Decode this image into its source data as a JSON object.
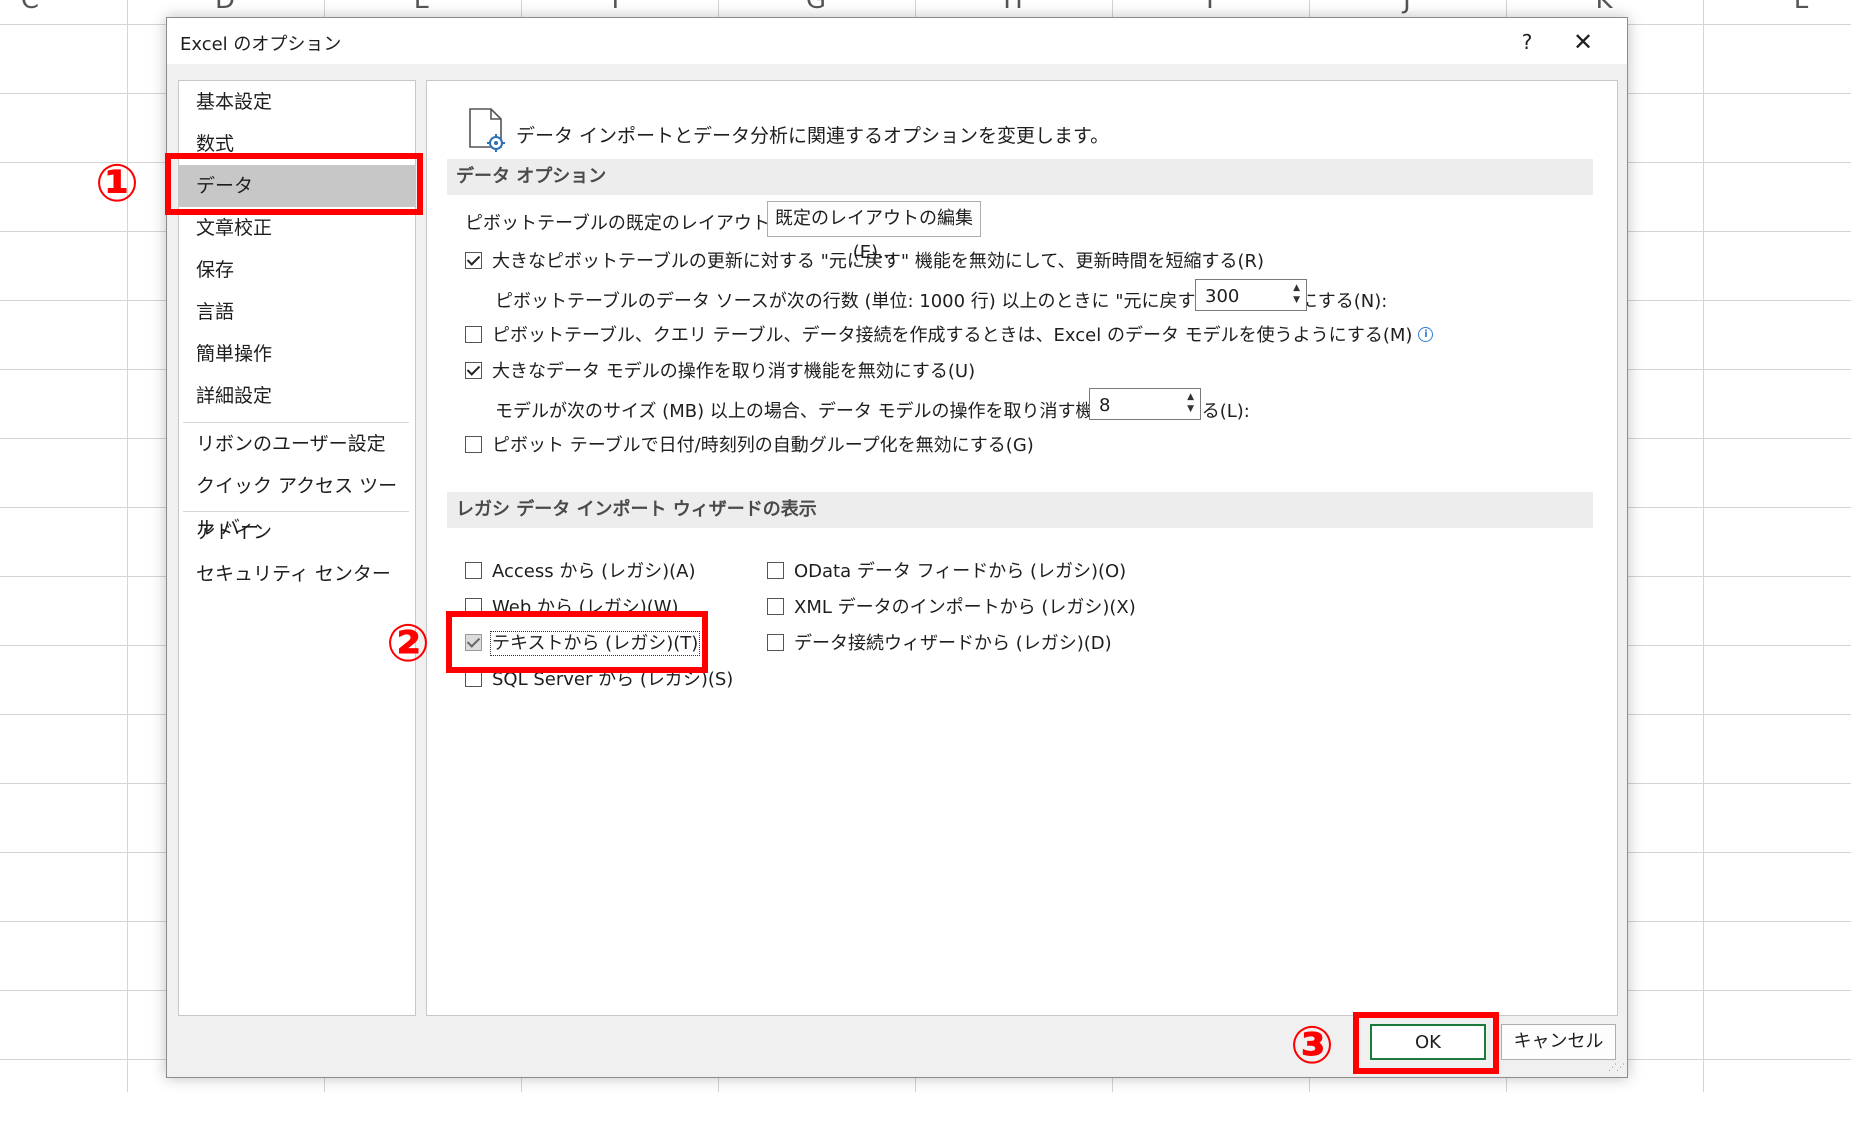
{
  "sheet": {
    "column_letters": [
      "C",
      "D",
      "E",
      "F",
      "G",
      "H",
      "I",
      "J",
      "K",
      "L"
    ]
  },
  "dialog": {
    "title": "Excel のオプション",
    "help_label": "?",
    "close_label": "✕"
  },
  "nav": {
    "items": [
      {
        "label": "基本設定"
      },
      {
        "label": "数式"
      },
      {
        "label": "データ"
      },
      {
        "label": "文章校正"
      },
      {
        "label": "保存"
      },
      {
        "label": "言語"
      },
      {
        "label": "簡単操作"
      },
      {
        "label": "詳細設定"
      },
      {
        "label": "リボンのユーザー設定"
      },
      {
        "label": "クイック アクセス ツール バー"
      },
      {
        "label": "アドイン"
      },
      {
        "label": "セキュリティ センター"
      }
    ],
    "selected": "データ"
  },
  "content": {
    "header": "データ インポートとデータ分析に関連するオプションを変更します。",
    "header_icon": "document-settings-icon",
    "section1": {
      "title": "データ オプション",
      "pivot_layout_label": "ピボットテーブルの既定のレイアウトを変更する:",
      "pivot_layout_button": "既定のレイアウトの編集(E)...",
      "opt_undo_large_pivot": {
        "label": "大きなピボットテーブルの更新に対する \"元に戻す\" 機能を無効にして、更新時間を短縮する(R)",
        "checked": true
      },
      "pivot_rows_label": "ピボットテーブルのデータ ソースが次の行数 (単位: 1000 行) 以上のときに \"元に戻す\" 機能を無効にする(N):",
      "pivot_rows_value": "300",
      "opt_data_model": {
        "label": "ピボットテーブル、クエリ テーブル、データ接続を作成するときは、Excel のデータ モデルを使うようにする(M)",
        "checked": false
      },
      "opt_undo_large_model": {
        "label": "大きなデータ モデルの操作を取り消す機能を無効にする(U)",
        "checked": true
      },
      "model_size_label": "モデルが次のサイズ (MB) 以上の場合、データ モデルの操作を取り消す機能を無効にする(L):",
      "model_size_value": "8",
      "opt_auto_group": {
        "label": "ピボット テーブルで日付/時刻列の自動グループ化を無効にする(G)",
        "checked": false
      }
    },
    "section2": {
      "title": "レガシ データ インポート ウィザードの表示",
      "left": [
        {
          "label": "Access から (レガシ)(A)",
          "checked": false
        },
        {
          "label": "Web から (レガシ)(W)",
          "checked": false
        },
        {
          "label": "テキストから (レガシ)(T)",
          "checked": true
        },
        {
          "label": "SQL Server から (レガシ)(S)",
          "checked": false
        }
      ],
      "right": [
        {
          "label": "OData データ フィードから (レガシ)(O)",
          "checked": false
        },
        {
          "label": "XML データのインポートから (レガシ)(X)",
          "checked": false
        },
        {
          "label": "データ接続ウィザードから (レガシ)(D)",
          "checked": false
        }
      ]
    }
  },
  "footer": {
    "ok_label": "OK",
    "cancel_label": "キャンセル"
  },
  "annotations": {
    "label1": "①",
    "label2": "②",
    "label3": "③",
    "color": "#ff0000"
  }
}
